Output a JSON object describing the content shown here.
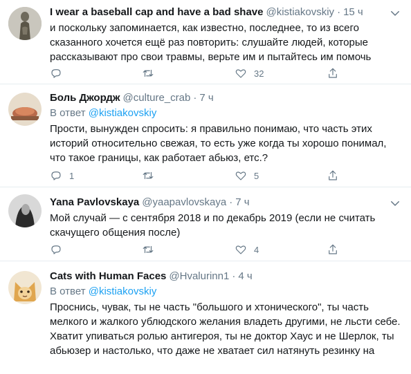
{
  "tweets": [
    {
      "name": "I wear a baseball cap and have a bad shave",
      "handle": "@kistiakovskiy",
      "time": "15 ч",
      "reply_prefix": "",
      "reply_mention": "",
      "text": "и поскольку запоминается, как известно, последнее, то из всего сказанного хочется ещё раз повторить: слушайте людей, которые рассказывают про свои травмы, верьте им и пытайтесь им помочь",
      "reply_count": "",
      "retweet_count": "",
      "like_count": "32"
    },
    {
      "name": "Боль Джордж",
      "handle": "@culture_crab",
      "time": "7 ч",
      "reply_prefix": "В ответ",
      "reply_mention": "@kistiakovskiy",
      "text": "Прости, вынужден спросить: я правильно понимаю, что часть этих историй относительно свежая, то есть уже когда ты хорошо понимал, что такое границы, как работает абьюз, етс.?",
      "reply_count": "1",
      "retweet_count": "",
      "like_count": "5"
    },
    {
      "name": "Yana Pavlovskaya",
      "handle": "@yaapavlovskaya",
      "time": "7 ч",
      "reply_prefix": "",
      "reply_mention": "",
      "text": "Мой случай — с сентября 2018 и по декабрь 2019 (если не считать скачущего общения после)",
      "reply_count": "",
      "retweet_count": "",
      "like_count": "4"
    },
    {
      "name": "Cats with Human Faces",
      "handle": "@Hvalurinn1",
      "time": "4 ч",
      "reply_prefix": "В ответ",
      "reply_mention": "@kistiakovskiy",
      "text": "Проснись, чувак, ты не часть \"большого и хтонического\", ты часть мелкого и жалкого ублюдского желания владеть другими, не льсти себе. Хватит упиваться ролью антигероя, ты не доктор Хаус и не Шерлок, ты абьюзер и настолько, что даже не хватает сил натянуть резинку на",
      "reply_count": "",
      "retweet_count": "",
      "like_count": ""
    }
  ],
  "separator": "·",
  "icons": {
    "reply": "reply-icon",
    "retweet": "retweet-icon",
    "like": "heart-icon",
    "share": "share-icon",
    "menu": "chevron-down-icon"
  },
  "colors": {
    "link": "#1da1f2",
    "muted": "#657786",
    "text": "#14171a",
    "border": "#e6ecf0"
  }
}
